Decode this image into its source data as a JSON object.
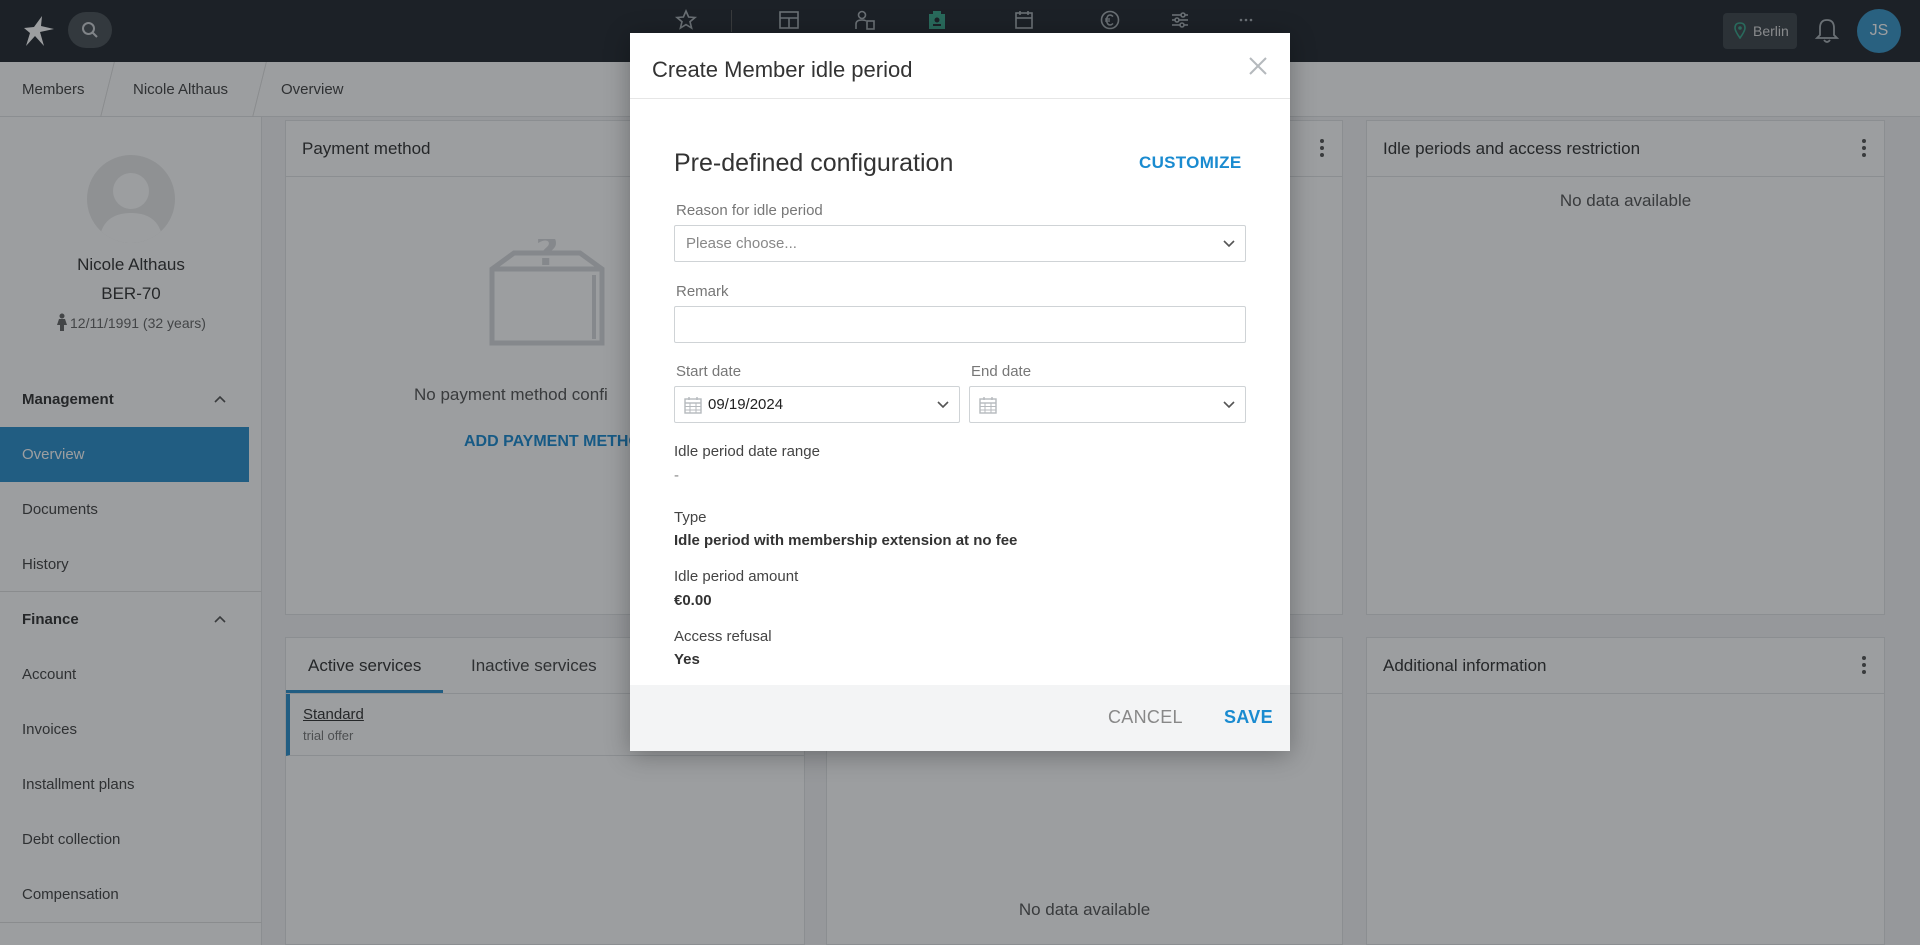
{
  "topbar": {
    "location_label": "Berlin",
    "user_initials": "JS",
    "nav_icons": [
      "star-icon",
      "dashboard-icon",
      "members-icon",
      "member-card-icon",
      "calendar-icon",
      "euro-icon",
      "settings-sliders-icon",
      "more-icon"
    ]
  },
  "breadcrumb": [
    "Members",
    "Nicole Althaus",
    "Overview"
  ],
  "profile": {
    "name": "Nicole Althaus",
    "member_id": "BER-70",
    "dob": "12/11/1991 (32 years)"
  },
  "sidebar": {
    "management_label": "Management",
    "management_items": [
      "Overview",
      "Documents",
      "History"
    ],
    "finance_label": "Finance",
    "finance_items": [
      "Account",
      "Invoices",
      "Installment plans",
      "Debt collection",
      "Compensation"
    ]
  },
  "cards": {
    "payment": {
      "title": "Payment method",
      "empty_text": "No payment method confi",
      "add_label": "ADD PAYMENT METHO"
    },
    "idle": {
      "title": "Idle periods and access restriction",
      "empty_text": "No data available"
    },
    "services": {
      "tabs": [
        "Active services",
        "Inactive services"
      ],
      "item_name": "Standard",
      "item_sub": "trial offer"
    },
    "middle_bottom": {
      "empty_text": "No data available"
    },
    "additional": {
      "title": "Additional information"
    }
  },
  "modal": {
    "title": "Create Member idle period",
    "section_title": "Pre-defined configuration",
    "customize_label": "CUSTOMIZE",
    "reason_label": "Reason for idle period",
    "reason_placeholder": "Please choose...",
    "remark_label": "Remark",
    "remark_value": "",
    "start_label": "Start date",
    "start_value": "09/19/2024",
    "end_label": "End date",
    "end_value": "",
    "range_label": "Idle period date range",
    "range_value": "-",
    "type_label": "Type",
    "type_value": "Idle period with membership extension at no fee",
    "amount_label": "Idle period amount",
    "amount_value": "€0.00",
    "refusal_label": "Access refusal",
    "refusal_value": "Yes",
    "cancel_label": "CANCEL",
    "save_label": "SAVE"
  },
  "colors": {
    "accent": "#1a8bd0",
    "sidebar_active": "#2b8fcc",
    "topbar": "#23292f",
    "active_nav_icon": "#3aa58a"
  }
}
